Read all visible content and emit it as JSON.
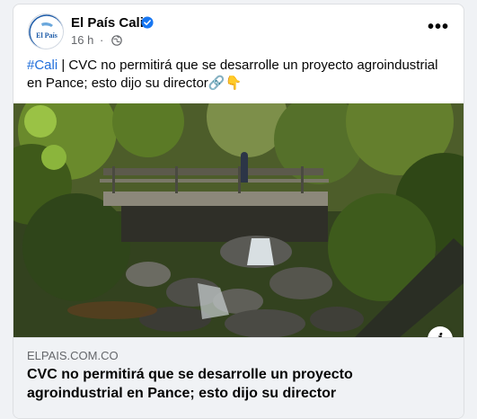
{
  "post": {
    "page_name": "El País Cali",
    "avatar_text": "El País",
    "time": "16 h",
    "separator": "·",
    "more_label": "•••",
    "hashtag": "#Cali",
    "body_text": " | CVC no permitirá que se desarrolle un proyecto agroindustrial en Pance; esto dijo su director🔗👇"
  },
  "link_preview": {
    "domain": "ELPAIS.COM.CO",
    "headline": "CVC no permitirá que se desarrolle un proyecto agroindustrial en Pance; esto dijo su director",
    "info_label": "i"
  },
  "colors": {
    "hashtag": "#216fdb",
    "verified": "#1877f2",
    "logo_blue": "#1b5aa8"
  }
}
